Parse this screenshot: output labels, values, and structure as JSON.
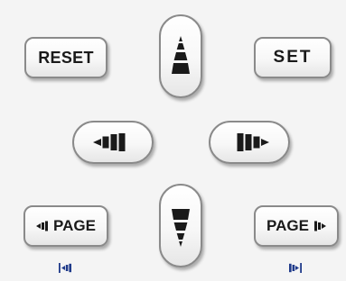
{
  "controls": {
    "reset_label": "RESET",
    "set_label": "SET",
    "page_prev_label": "PAGE",
    "page_next_label": "PAGE"
  },
  "icons": {
    "up": "up-arrow-icon",
    "down": "down-arrow-icon",
    "left": "rewind-left-icon",
    "right": "forward-right-icon",
    "first": "skip-to-start-icon",
    "last": "skip-to-end-icon"
  },
  "colors": {
    "background": "#f4f4f4",
    "button_border": "#8a8a8a",
    "glyph": "#1a1a1a",
    "hint_icon": "#1f3a8a"
  }
}
